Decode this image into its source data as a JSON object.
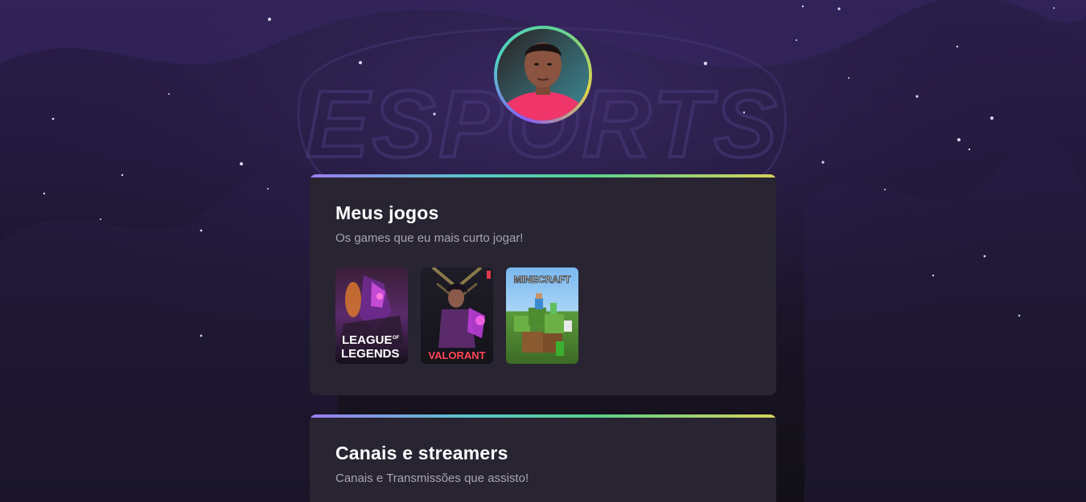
{
  "profile": {
    "avatar_alt": "Foto de perfil"
  },
  "background": {
    "logo_text": "ESPORTS"
  },
  "sections": [
    {
      "title": "Meus jogos",
      "subtitle": "Os games que eu mais curto jogar!",
      "games": [
        {
          "name": "League of Legends",
          "logo_line1": "LEAGUE",
          "logo_of": "OF",
          "logo_line2": "LEGENDS"
        },
        {
          "name": "Valorant",
          "logo": "VALORANT"
        },
        {
          "name": "Minecraft",
          "logo": "MINECRAFT"
        }
      ]
    },
    {
      "title": "Canais e streamers",
      "subtitle": "Canais e Transmissões que assisto!"
    }
  ],
  "colors": {
    "card_bg": "#282432",
    "gradient_bar": [
      "#9b7cf3",
      "#57c7c9",
      "#57d28c",
      "#d7d35a"
    ],
    "subtitle": "#a8a4b4"
  }
}
